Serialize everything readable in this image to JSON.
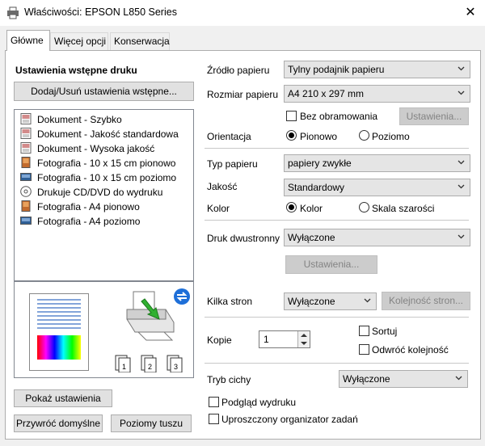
{
  "window": {
    "title": "Właściwości: EPSON L850 Series",
    "close_label": "✕"
  },
  "tabs": [
    {
      "label": "Główne"
    },
    {
      "label": "Więcej opcji"
    },
    {
      "label": "Konserwacja"
    }
  ],
  "left": {
    "presets_heading": "Ustawienia wstępne druku",
    "add_remove_label": "Dodaj/Usuń ustawienia wstępne...",
    "presets": [
      {
        "label": "Dokument - Szybko",
        "icon": "document-icon"
      },
      {
        "label": "Dokument - Jakość standardowa",
        "icon": "document-icon"
      },
      {
        "label": "Dokument - Wysoka jakość",
        "icon": "document-icon"
      },
      {
        "label": "Fotografia - 10 x 15 cm pionowo",
        "icon": "photo-portrait-icon"
      },
      {
        "label": "Fotografia - 10 x 15 cm poziomo",
        "icon": "photo-landscape-icon"
      },
      {
        "label": "Drukuje CD/DVD do wydruku",
        "icon": "cd-icon"
      },
      {
        "label": "Fotografia - A4 pionowo",
        "icon": "photo-portrait-icon"
      },
      {
        "label": "Fotografia - A4 poziomo",
        "icon": "photo-landscape-icon"
      }
    ],
    "copies_icons": [
      "1",
      "2",
      "3"
    ],
    "show_settings_label": "Pokaż ustawienia",
    "restore_defaults_label": "Przywróć domyślne",
    "ink_levels_label": "Poziomy tuszu"
  },
  "right": {
    "paper_source_label": "Źródło papieru",
    "paper_source_value": "Tylny podajnik papieru",
    "paper_size_label": "Rozmiar papieru",
    "paper_size_value": "A4 210 x 297 mm",
    "borderless_label": "Bez obramowania",
    "borderless_settings_label": "Ustawienia...",
    "orientation_label": "Orientacja",
    "orientation_portrait": "Pionowo",
    "orientation_landscape": "Poziomo",
    "paper_type_label": "Typ papieru",
    "paper_type_value": "papiery zwykłe",
    "quality_label": "Jakość",
    "quality_value": "Standardowy",
    "color_label": "Kolor",
    "color_color": "Kolor",
    "color_grayscale": "Skala szarości",
    "duplex_label": "Druk dwustronny",
    "duplex_value": "Wyłączone",
    "duplex_settings_label": "Ustawienia...",
    "multipage_label": "Kilka stron",
    "multipage_value": "Wyłączone",
    "page_order_label": "Kolejność stron...",
    "copies_label": "Kopie",
    "copies_value": "1",
    "collate_label": "Sortuj",
    "reverse_order_label": "Odwróć kolejność",
    "quiet_mode_label": "Tryb cichy",
    "quiet_mode_value": "Wyłączone",
    "print_preview_label": "Podgląd wydruku",
    "job_arranger_label": "Uproszczony organizator zadań"
  },
  "colors": {
    "selected_tab": "#ffffff",
    "frame": "#f0f0f0",
    "accent_blue": "#0078d7"
  }
}
